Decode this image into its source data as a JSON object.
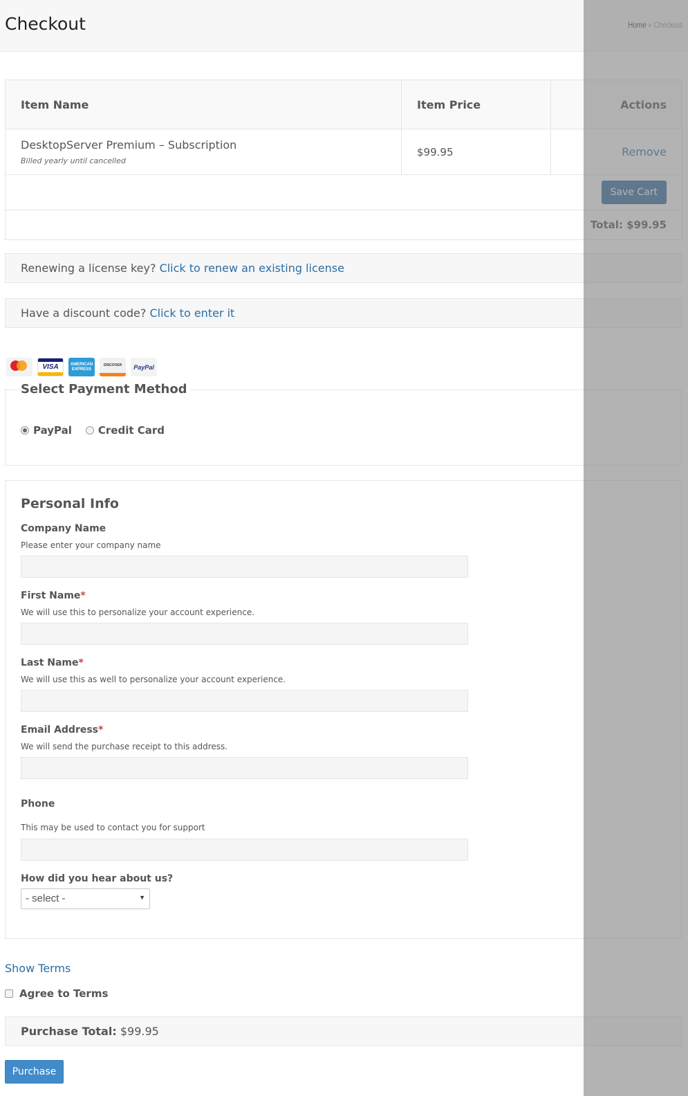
{
  "header": {
    "title": "Checkout",
    "breadcrumb": {
      "home": "Home",
      "separator": "»",
      "current": "Checkout"
    }
  },
  "cart": {
    "columns": {
      "name": "Item Name",
      "price": "Item Price",
      "actions": "Actions"
    },
    "items": [
      {
        "name": "DesktopServer Premium – Subscription",
        "note": "Billed yearly until cancelled",
        "price": "$99.95",
        "action": "Remove"
      }
    ],
    "save_label": "Save Cart",
    "total": "Total: $99.95"
  },
  "renew": {
    "text": "Renewing a license key?",
    "link": "Click to renew an existing license"
  },
  "discount": {
    "text": "Have a discount code?",
    "link": "Click to enter it"
  },
  "cards": {
    "mastercard": "mastercard",
    "visa": "VISA",
    "amex": "AMERICAN EXPRESS",
    "discover": "DISCOVER",
    "paypal": "PayPal"
  },
  "payment": {
    "title": "Select Payment Method",
    "options": [
      {
        "label": "PayPal",
        "selected": true
      },
      {
        "label": "Credit Card",
        "selected": false
      }
    ]
  },
  "personal": {
    "title": "Personal Info",
    "fields": [
      {
        "label": "Company Name",
        "required": false,
        "desc": "Please enter your company name",
        "value": ""
      },
      {
        "label": "First Name",
        "required": true,
        "desc": "We will use this to personalize your account experience.",
        "value": ""
      },
      {
        "label": "Last Name",
        "required": true,
        "desc": "We will use this as well to personalize your account experience.",
        "value": ""
      },
      {
        "label": "Email Address",
        "required": true,
        "desc": "We will send the purchase receipt to this address.",
        "value": ""
      },
      {
        "label": "Phone",
        "required": false,
        "desc": "This may be used to contact you for support",
        "value": ""
      }
    ],
    "req_mark": "*",
    "hear": {
      "label": "How did you hear about us?",
      "selected": "- select -"
    }
  },
  "terms": {
    "show": "Show Terms",
    "agree": "Agree to Terms"
  },
  "purchase": {
    "label": "Purchase Total:",
    "amount": "$99.95",
    "button": "Purchase"
  }
}
